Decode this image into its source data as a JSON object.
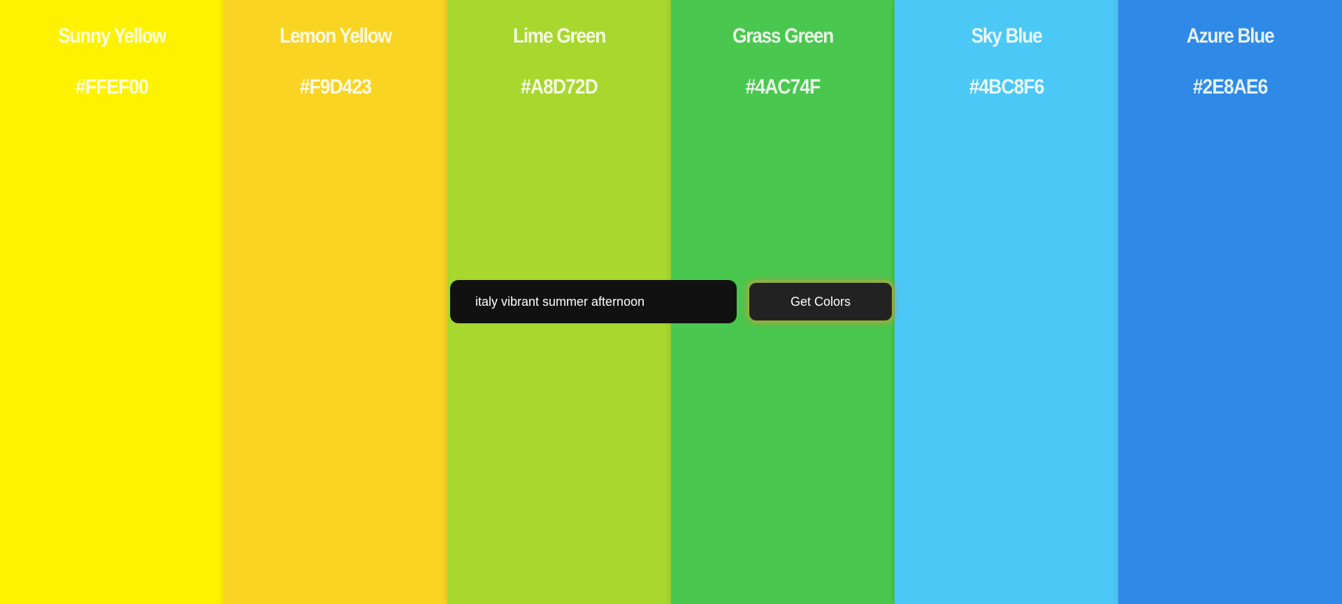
{
  "swatches": [
    {
      "name": "Sunny Yellow",
      "hex": "#FFEF00",
      "color": "#FFF200"
    },
    {
      "name": "Lemon Yellow",
      "hex": "#F9D423",
      "color": "#F9D423"
    },
    {
      "name": "Lime Green",
      "hex": "#A8D72D",
      "color": "#A8D72D"
    },
    {
      "name": "Grass Green",
      "hex": "#4AC74F",
      "color": "#4AC74F"
    },
    {
      "name": "Sky Blue",
      "hex": "#4BC8F6",
      "color": "#4BC8F6"
    },
    {
      "name": "Azure Blue",
      "hex": "#2E8AE6",
      "color": "#2E8AE6"
    }
  ],
  "search": {
    "value": "italy vibrant summer afternoon"
  },
  "button": {
    "label": "Get Colors"
  }
}
